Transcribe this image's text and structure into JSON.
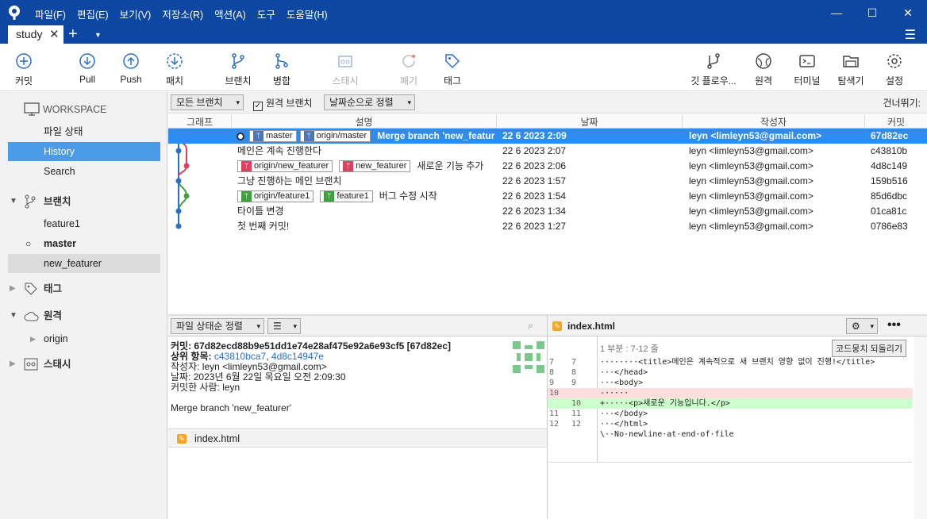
{
  "menu": [
    "파일(F)",
    "편집(E)",
    "보기(V)",
    "저장소(R)",
    "액션(A)",
    "도구",
    "도움말(H)"
  ],
  "tab": {
    "label": "study"
  },
  "toolbar": {
    "commit": "커밋",
    "pull": "Pull",
    "push": "Push",
    "fetch": "패치",
    "branch": "브랜치",
    "merge": "병합",
    "stash": "스태시",
    "discard": "폐기",
    "tag": "태그",
    "gitflow": "깃 플로우...",
    "remote": "원격",
    "terminal": "터미널",
    "explorer": "탐색기",
    "settings": "설정"
  },
  "sidebar": {
    "workspace": "WORKSPACE",
    "file_status": "파일 상태",
    "history": "History",
    "search": "Search",
    "branches": "브랜치",
    "feature1": "feature1",
    "master": "master",
    "new_featurer": "new_featurer",
    "tags": "태그",
    "remotes": "원격",
    "origin": "origin",
    "stashes": "스태시"
  },
  "filters": {
    "branches": "모든 브랜치",
    "remote": "원격 브랜치",
    "sort": "날짜순으로 정렬",
    "skip": "건너뛰기:"
  },
  "columns": {
    "graph": "그래프",
    "desc": "설명",
    "date": "날짜",
    "author": "작성자",
    "commit": "커밋"
  },
  "commits": [
    {
      "tags": [
        "master",
        "origin/master"
      ],
      "msg": "Merge branch 'new_featurer'",
      "date": "22 6 2023 2:09",
      "author": "leyn <limleyn53@gmail.com>",
      "hash": "67d82ec"
    },
    {
      "tags": [],
      "msg": "메인은 계속 진행한다",
      "date": "22 6 2023 2:07",
      "author": "leyn <limleyn53@gmail.com>",
      "hash": "c43810b"
    },
    {
      "tags": [
        "origin/new_featurer",
        "new_featurer"
      ],
      "msg": "새로운 기능 추가",
      "date": "22 6 2023 2:06",
      "author": "leyn <limleyn53@gmail.com>",
      "hash": "4d8c149"
    },
    {
      "tags": [],
      "msg": "그냥 진행하는 메인 브랜치",
      "date": "22 6 2023 1:57",
      "author": "leyn <limleyn53@gmail.com>",
      "hash": "159b516"
    },
    {
      "tags": [
        "origin/feature1",
        "feature1"
      ],
      "msg": "버그 수정 시작",
      "date": "22 6 2023 1:54",
      "author": "leyn <limleyn53@gmail.com>",
      "hash": "85d6dbc"
    },
    {
      "tags": [],
      "msg": "타이틀 변경",
      "date": "22 6 2023 1:34",
      "author": "leyn <limleyn53@gmail.com>",
      "hash": "01ca81c"
    },
    {
      "tags": [],
      "msg": "첫 번째 커밋!",
      "date": "22 6 2023 1:27",
      "author": "leyn <limleyn53@gmail.com>",
      "hash": "0786e83"
    }
  ],
  "detail": {
    "sort": "파일 상태순 정렬",
    "commit_line": "커밋: 67d82ecd88b9e51dd1e74e28af475e92a6e93cf5 [67d82ec]",
    "parents_label": "상위 항목:",
    "parent1": "c43810bca7",
    "parent2": "4d8c14947e",
    "author": "작성자: leyn <limleyn53@gmail.com>",
    "date": "날짜: 2023년 6월 22일 목요일 오전 2:09:30",
    "committer": "커밋한 사람: leyn",
    "message": "Merge branch 'new_featurer'",
    "file": "index.html"
  },
  "diff": {
    "file": "index.html",
    "hunk": "1 부분 : 7-12 줄",
    "revert": "코드뭉치 되돌리기",
    "lines": [
      {
        "a": "7",
        "b": "7",
        "t": "········<title>메인은 계속적으로 새 브랜치 영향 없이 진행!</title>",
        "k": ""
      },
      {
        "a": "8",
        "b": "8",
        "t": "···</head>",
        "k": ""
      },
      {
        "a": "9",
        "b": "9",
        "t": "···<body>",
        "k": ""
      },
      {
        "a": "10",
        "b": "",
        "t": "-·····",
        "k": "rem"
      },
      {
        "a": "",
        "b": "10",
        "t": "+·····<p>새로운 기능입니다.</p>",
        "k": "add"
      },
      {
        "a": "11",
        "b": "11",
        "t": "···</body>",
        "k": ""
      },
      {
        "a": "12",
        "b": "12",
        "t": "···</html>",
        "k": ""
      },
      {
        "a": "",
        "b": "",
        "t": "\\··No·newline·at·end·of·file",
        "k": ""
      }
    ]
  }
}
